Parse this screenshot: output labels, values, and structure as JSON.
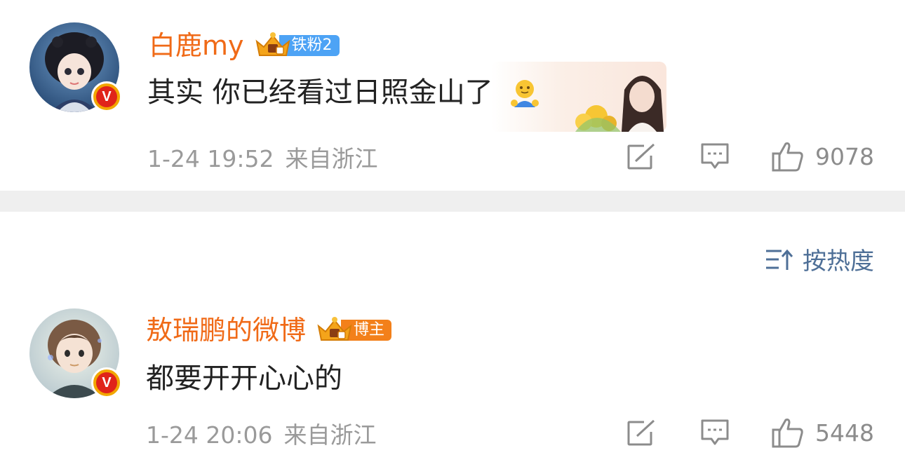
{
  "comments": [
    {
      "username": "白鹿my",
      "rank_label": "铁粉2",
      "content": "其实 你已经看过日照金山了",
      "emoji": "😀",
      "time": "1-24 19:52",
      "source": "来自浙江",
      "likes": "9078"
    },
    {
      "username": "敖瑞鹏的微博",
      "rank_label": "博主",
      "content": "都要开开心心的",
      "time": "1-24 20:06",
      "source": "来自浙江",
      "likes": "5448"
    }
  ],
  "sort": {
    "label": "按热度"
  },
  "verify_badge": "V",
  "colors": {
    "username": "#f06a17",
    "fan_badge": "#4da3f5",
    "blogger_badge": "#f3801a",
    "sort_text": "#4e6f97",
    "meta_text": "#9a9a9a"
  },
  "icons": [
    "share-icon",
    "comment-icon",
    "like-icon",
    "sort-icon",
    "crown-icon",
    "verified-icon"
  ]
}
